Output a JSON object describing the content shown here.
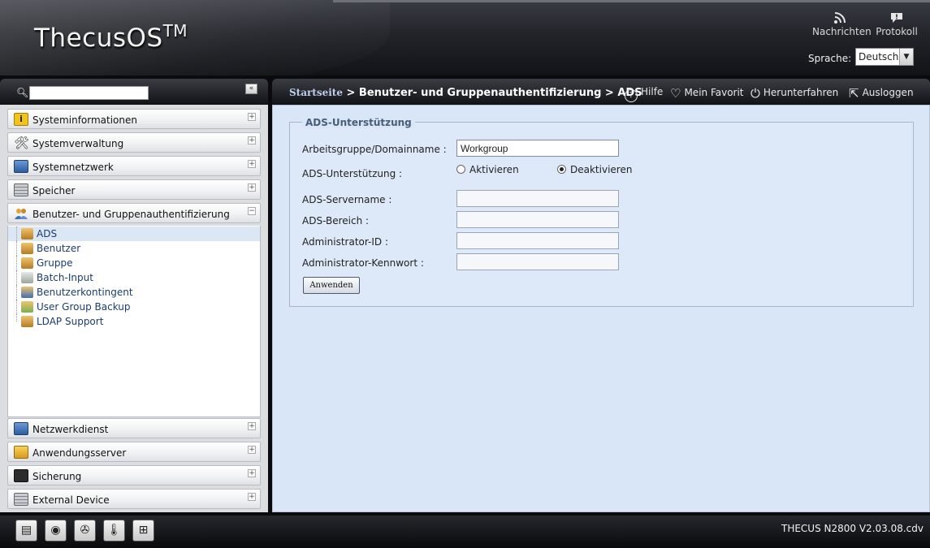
{
  "header": {
    "logo": "ThecusOS",
    "logo_tm": "TM",
    "news_label": "Nachrichten",
    "log_label": "Protokoll",
    "language_label": "Sprache:",
    "language_value": "Deutsch"
  },
  "sidebar": {
    "search_placeholder": "",
    "collapse_label": "«",
    "categories_top": [
      {
        "label": "Systeminformationen",
        "toggle": "+",
        "color": "#f2c318"
      },
      {
        "label": "Systemverwaltung",
        "toggle": "+",
        "color": "#8e9399"
      },
      {
        "label": "Systemnetzwerk",
        "toggle": "+",
        "color": "#3d6fb5"
      },
      {
        "label": "Speicher",
        "toggle": "+",
        "color": "#9ea3aa"
      },
      {
        "label": "Benutzer- und Gruppenauthentifizierung",
        "toggle": "−",
        "color": "#e1a23a"
      }
    ],
    "tree_items": [
      {
        "label": "ADS",
        "selected": true
      },
      {
        "label": "Benutzer"
      },
      {
        "label": "Gruppe"
      },
      {
        "label": "Batch-Input"
      },
      {
        "label": "Benutzerkontingent"
      },
      {
        "label": "User Group Backup"
      },
      {
        "label": "LDAP Support"
      }
    ],
    "categories_bottom": [
      {
        "label": "Netzwerkdienst",
        "toggle": "+",
        "color": "#3d6fb5"
      },
      {
        "label": "Anwendungsserver",
        "toggle": "+",
        "color": "#e9b52c"
      },
      {
        "label": "Sicherung",
        "toggle": "+",
        "color": "#3a3a3a"
      },
      {
        "label": "External Device",
        "toggle": "+",
        "color": "#9ea3aa"
      }
    ]
  },
  "toolbar": {
    "breadcrumb_home": "Startseite",
    "breadcrumb_rest": " > Benutzer- und Gruppenauthentifizierung > ADS",
    "help": "Hilfe",
    "favorite": "Mein Favorit",
    "shutdown": "Herunterfahren",
    "logout": "Ausloggen"
  },
  "form": {
    "legend": "ADS-Unterstützung",
    "workgroup_label": "Arbeitsgruppe/Domainname :",
    "workgroup_value": "Workgroup",
    "ads_support_label": "ADS-Unterstützung :",
    "radio_enable": "Aktivieren",
    "radio_disable": "Deaktivieren",
    "server_label": "ADS-Servername :",
    "realm_label": "ADS-Bereich :",
    "admin_id_label": "Administrator-ID :",
    "admin_pw_label": "Administrator-Kennwort :",
    "apply_label": "Anwenden"
  },
  "footer": {
    "version": "THECUS N2800 V2.03.08.cdv"
  }
}
